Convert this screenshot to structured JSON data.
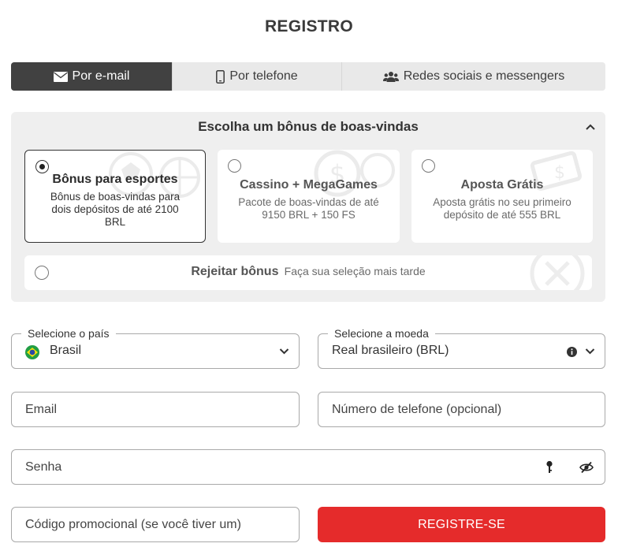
{
  "page": {
    "title": "REGISTRO"
  },
  "tabs": [
    {
      "label": "Por e-mail",
      "icon": "envelope-icon",
      "active": true
    },
    {
      "label": "Por telefone",
      "icon": "smartphone-icon",
      "active": false
    },
    {
      "label": "Redes sociais e messengers",
      "icon": "users-icon",
      "active": false
    }
  ],
  "bonus": {
    "heading": "Escolha um bônus de boas-vindas",
    "options": [
      {
        "title": "Bônus para esportes",
        "description": "Bônus de boas-vindas para dois depósitos de até 2100 BRL",
        "selected": true
      },
      {
        "title": "Cassino + MegaGames",
        "description": "Pacote de boas-vindas de até 9150 BRL + 150 FS",
        "selected": false
      },
      {
        "title": "Aposta Grátis",
        "description": "Aposta grátis no seu primeiro depósito de até 555 BRL",
        "selected": false
      }
    ],
    "reject": {
      "title": "Rejeitar bônus",
      "subtitle": "Faça sua seleção mais tarde"
    }
  },
  "form": {
    "country": {
      "label": "Selecione o país",
      "value": "Brasil"
    },
    "currency": {
      "label": "Selecione a moeda",
      "value": "Real brasileiro (BRL)"
    },
    "email": {
      "placeholder": "Email"
    },
    "phone": {
      "placeholder": "Número de telefone (opcional)"
    },
    "password": {
      "placeholder": "Senha"
    },
    "promo": {
      "placeholder": "Código promocional (se você tiver um)"
    },
    "submit_label": "REGISTRE-SE"
  },
  "colors": {
    "accent": "#e52b2b",
    "active_tab": "#414141",
    "panel": "#efefef"
  }
}
